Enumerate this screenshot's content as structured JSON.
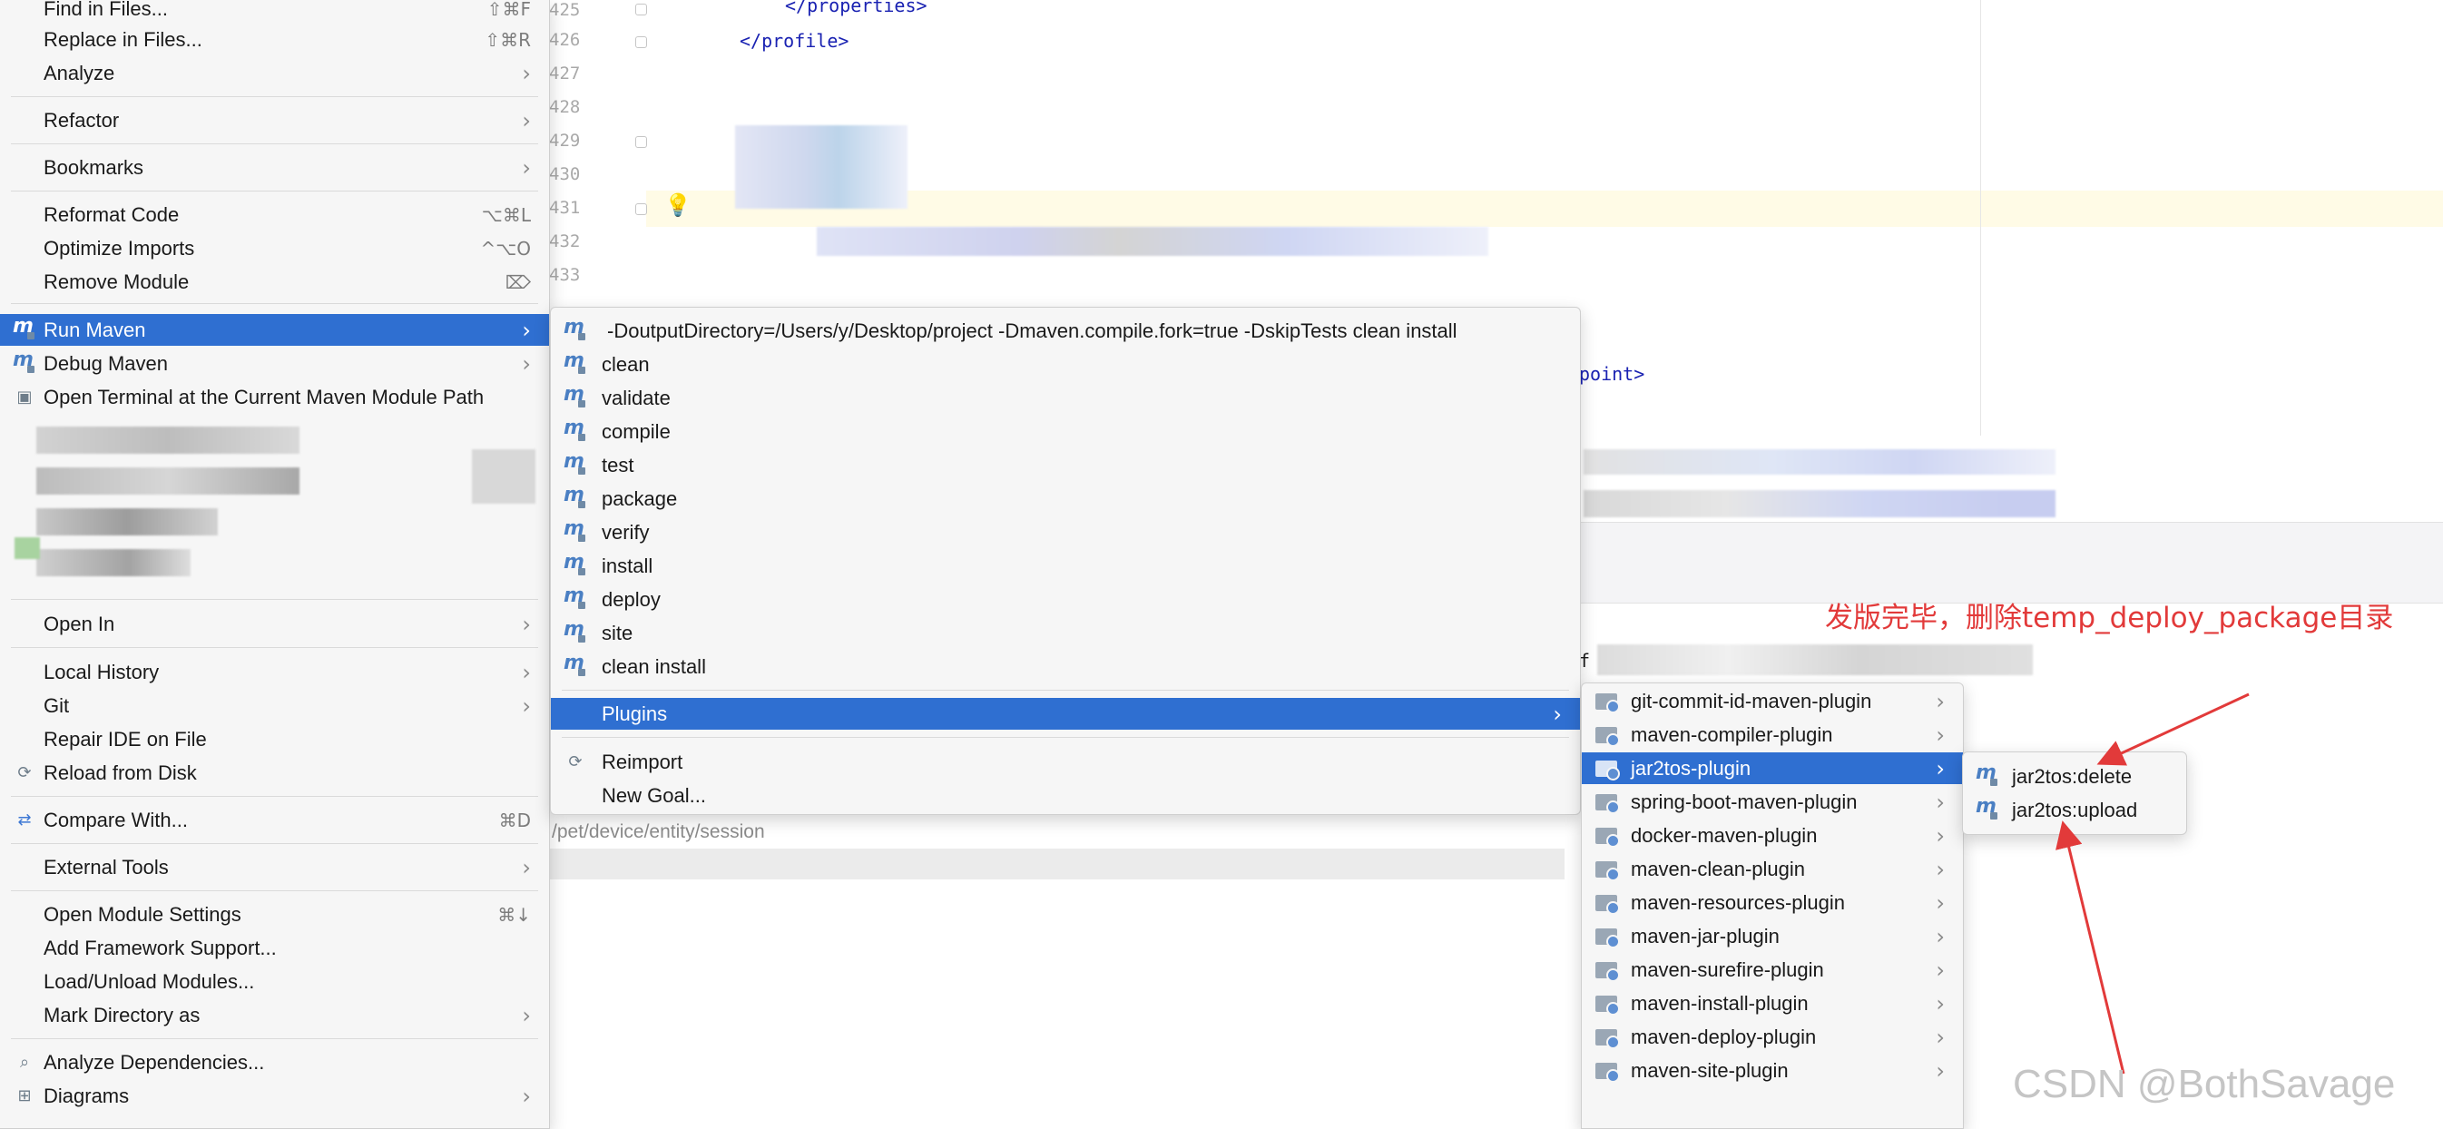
{
  "editor": {
    "line_numbers": [
      "425",
      "426",
      "427",
      "428",
      "429",
      "430",
      "431",
      "432",
      "433"
    ],
    "code_lines": [
      {
        "text": "</properties>",
        "indent": 1
      },
      {
        "text": "</profile>",
        "indent": 0
      }
    ],
    "code_fragment_right": "point>",
    "terminal_fragment": "f",
    "path_text": "/pet/device/entity/session"
  },
  "main_menu": {
    "items": [
      {
        "label": "Find in Files...",
        "shortcut": "⇧⌘F"
      },
      {
        "label": "Replace in Files...",
        "shortcut": "⇧⌘R"
      },
      {
        "label": "Analyze",
        "submenu": true
      },
      {
        "label": "Refactor",
        "submenu": true
      },
      {
        "label": "Bookmarks",
        "submenu": true
      },
      {
        "label": "Reformat Code",
        "shortcut": "⌥⌘L"
      },
      {
        "label": "Optimize Imports",
        "shortcut": "^⌥O"
      },
      {
        "label": "Remove Module",
        "shortcut": "⌦"
      },
      {
        "label": "Run Maven",
        "submenu": true,
        "selected": true,
        "icon": "maven-run-icon"
      },
      {
        "label": "Debug Maven",
        "submenu": true,
        "icon": "maven-debug-icon"
      },
      {
        "label": "Open Terminal at the Current Maven Module Path",
        "icon": "terminal-maven-icon"
      },
      {
        "label": "Open In",
        "submenu": true
      },
      {
        "label": "Local History",
        "submenu": true
      },
      {
        "label": "Git",
        "submenu": true
      },
      {
        "label": "Repair IDE on File"
      },
      {
        "label": "Reload from Disk",
        "icon": "reload-icon"
      },
      {
        "label": "Compare With...",
        "shortcut": "⌘D",
        "icon": "compare-icon"
      },
      {
        "label": "External Tools",
        "submenu": true
      },
      {
        "label": "Open Module Settings",
        "shortcut": "⌘↓"
      },
      {
        "label": "Add Framework Support..."
      },
      {
        "label": "Load/Unload Modules..."
      },
      {
        "label": "Mark Directory as",
        "submenu": true
      },
      {
        "label": "Analyze Dependencies...",
        "icon": "analyze-deps-icon"
      },
      {
        "label": "Diagrams",
        "submenu": true,
        "icon": "diagram-icon"
      }
    ]
  },
  "run_maven_menu": {
    "items": [
      "-DoutputDirectory=/Users/y/Desktop/project -Dmaven.compile.fork=true -DskipTests clean install",
      "clean",
      "validate",
      "compile",
      "test",
      "package",
      "verify",
      "install",
      "deploy",
      "site",
      "clean install"
    ],
    "plugins_label": "Plugins",
    "reimport_label": "Reimport",
    "new_goal_label": "New Goal..."
  },
  "plugins_menu": {
    "items": [
      "git-commit-id-maven-plugin",
      "maven-compiler-plugin",
      "jar2tos-plugin",
      "spring-boot-maven-plugin",
      "docker-maven-plugin",
      "maven-clean-plugin",
      "maven-resources-plugin",
      "maven-jar-plugin",
      "maven-surefire-plugin",
      "maven-install-plugin",
      "maven-deploy-plugin",
      "maven-site-plugin"
    ],
    "selected_index": 2
  },
  "jar2tos_menu": {
    "items": [
      "jar2tos:delete",
      "jar2tos:upload"
    ]
  },
  "annotation": {
    "text": "发版完毕，删除temp_deploy_package目录",
    "color": "#e23a3a"
  },
  "watermark": "CSDN @BothSavage",
  "colors": {
    "selection": "#2f6fd1",
    "menu_bg": "#f6f6f6"
  }
}
